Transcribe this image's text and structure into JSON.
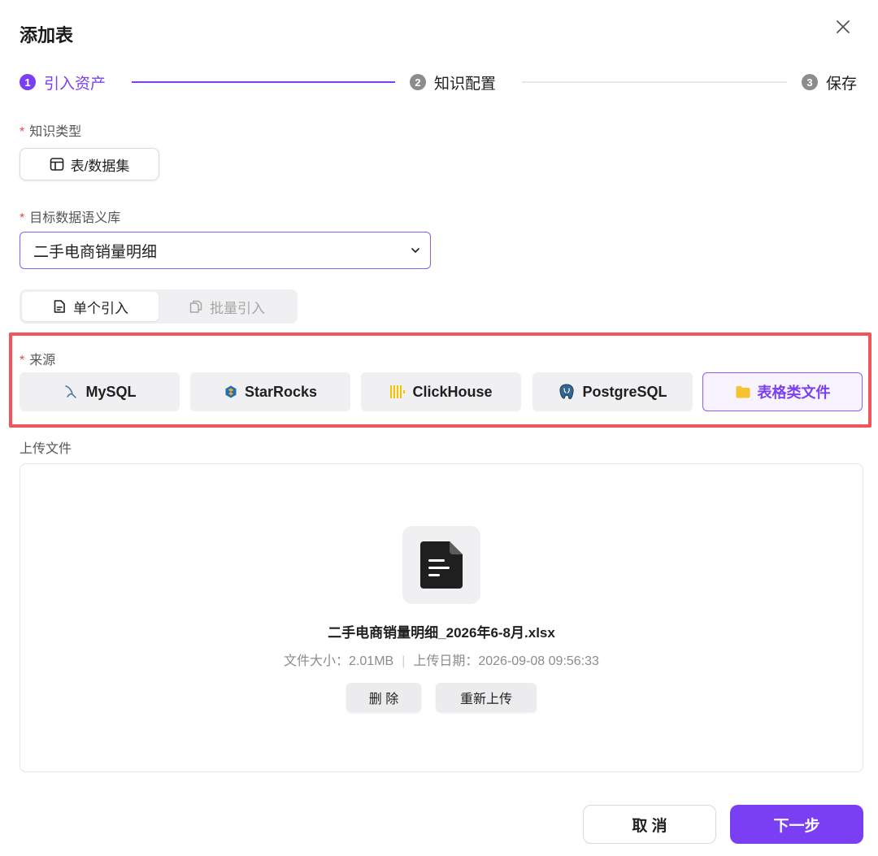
{
  "dialog": {
    "title": "添加表",
    "close_icon": "close-icon"
  },
  "steps": [
    {
      "number": "1",
      "label": "引入资产",
      "state": "active"
    },
    {
      "number": "2",
      "label": "知识配置",
      "state": "pending"
    },
    {
      "number": "3",
      "label": "保存",
      "state": "pending"
    }
  ],
  "knowledge_type": {
    "required_mark": "*",
    "label": "知识类型",
    "option_label": "表/数据集",
    "icon": "table-icon"
  },
  "target_library": {
    "required_mark": "*",
    "label": "目标数据语义库",
    "value": "二手电商销量明细",
    "icon": "chevron-down-icon"
  },
  "import_mode": {
    "single": {
      "label": "单个引入",
      "icon": "document-icon",
      "selected": true
    },
    "batch": {
      "label": "批量引入",
      "icon": "copy-icon",
      "selected": false
    }
  },
  "source": {
    "required_mark": "*",
    "label": "来源",
    "options": [
      {
        "label": "MySQL",
        "icon": "mysql-dolphin-icon"
      },
      {
        "label": "StarRocks",
        "icon": "starrocks-icon"
      },
      {
        "label": "ClickHouse",
        "icon": "clickhouse-bars-icon"
      },
      {
        "label": "PostgreSQL",
        "icon": "postgresql-elephant-icon"
      },
      {
        "label": "表格类文件",
        "icon": "folder-icon",
        "selected": true
      }
    ]
  },
  "upload": {
    "label": "上传文件",
    "file_icon": "file-icon",
    "file_name": "二手电商销量明细_2026年6-8月.xlsx",
    "size_text": "文件大小：2.01MB",
    "separator": "|",
    "date_text": "上传日期：2026-09-08 09:56:33",
    "delete_label": "删 除",
    "reupload_label": "重新上传"
  },
  "footer": {
    "cancel_label": "取 消",
    "next_label": "下一步"
  },
  "colors": {
    "accent": "#7a3ff2",
    "highlight_border": "#f2545b",
    "required": "#e5484d"
  }
}
